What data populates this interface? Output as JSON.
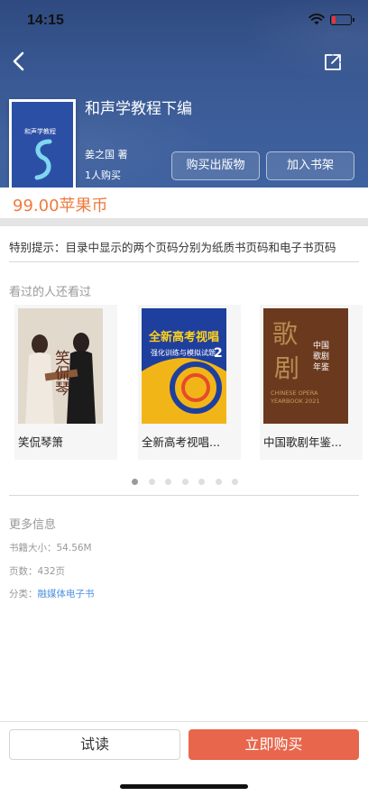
{
  "status_bar": {
    "time": "14:15"
  },
  "book": {
    "title": "和声学教程下编",
    "author": "姜之国 著",
    "buyers": "1人购买",
    "cover_title": "和声学教程",
    "price": "99.00苹果币"
  },
  "actions": {
    "buy_print": "购买出版物",
    "add_shelf": "加入书架",
    "trial_read": "试读",
    "buy_now": "立即购买"
  },
  "notice": "特别提示：目录中显示的两个页码分别为纸质书页码和电子书页码",
  "recommend": {
    "title": "看过的人还看过",
    "items": [
      {
        "name": "笑侃琴箫"
      },
      {
        "name": "全新高考视唱..."
      },
      {
        "name": "中国歌剧年鉴..."
      }
    ],
    "page_count": 7,
    "active_page": 1
  },
  "more_info": {
    "title": "更多信息",
    "size": "书籍大小：54.56M",
    "pages": "页数：432页",
    "category_label": "分类：",
    "category": "融媒体电子书"
  },
  "colors": {
    "header": "#3a5a95",
    "price": "#ee7a3e",
    "buy_button": "#e8664b",
    "link": "#4a90e2"
  }
}
